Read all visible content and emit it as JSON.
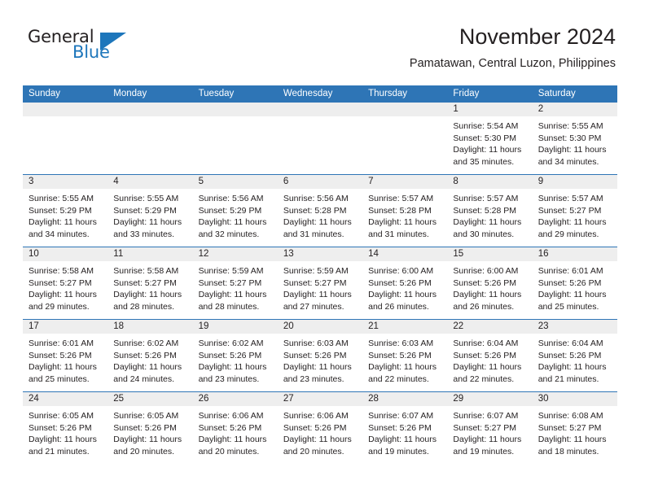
{
  "logo": {
    "word_top": "General",
    "word_bottom": "Blue",
    "triangle_color": "#1d76bb"
  },
  "header": {
    "title": "November 2024",
    "subtitle": "Pamatawan, Central Luzon, Philippines"
  },
  "colors": {
    "header_blue": "#2e75b6",
    "daynum_band": "#eeeeee",
    "text": "#231f20"
  },
  "weekdays": [
    "Sunday",
    "Monday",
    "Tuesday",
    "Wednesday",
    "Thursday",
    "Friday",
    "Saturday"
  ],
  "weeks": [
    [
      {
        "empty": true
      },
      {
        "empty": true
      },
      {
        "empty": true
      },
      {
        "empty": true
      },
      {
        "empty": true
      },
      {
        "day": "1",
        "sunrise": "Sunrise: 5:54 AM",
        "sunset": "Sunset: 5:30 PM",
        "daylight1": "Daylight: 11 hours",
        "daylight2": "and 35 minutes."
      },
      {
        "day": "2",
        "sunrise": "Sunrise: 5:55 AM",
        "sunset": "Sunset: 5:30 PM",
        "daylight1": "Daylight: 11 hours",
        "daylight2": "and 34 minutes."
      }
    ],
    [
      {
        "day": "3",
        "sunrise": "Sunrise: 5:55 AM",
        "sunset": "Sunset: 5:29 PM",
        "daylight1": "Daylight: 11 hours",
        "daylight2": "and 34 minutes."
      },
      {
        "day": "4",
        "sunrise": "Sunrise: 5:55 AM",
        "sunset": "Sunset: 5:29 PM",
        "daylight1": "Daylight: 11 hours",
        "daylight2": "and 33 minutes."
      },
      {
        "day": "5",
        "sunrise": "Sunrise: 5:56 AM",
        "sunset": "Sunset: 5:29 PM",
        "daylight1": "Daylight: 11 hours",
        "daylight2": "and 32 minutes."
      },
      {
        "day": "6",
        "sunrise": "Sunrise: 5:56 AM",
        "sunset": "Sunset: 5:28 PM",
        "daylight1": "Daylight: 11 hours",
        "daylight2": "and 31 minutes."
      },
      {
        "day": "7",
        "sunrise": "Sunrise: 5:57 AM",
        "sunset": "Sunset: 5:28 PM",
        "daylight1": "Daylight: 11 hours",
        "daylight2": "and 31 minutes."
      },
      {
        "day": "8",
        "sunrise": "Sunrise: 5:57 AM",
        "sunset": "Sunset: 5:28 PM",
        "daylight1": "Daylight: 11 hours",
        "daylight2": "and 30 minutes."
      },
      {
        "day": "9",
        "sunrise": "Sunrise: 5:57 AM",
        "sunset": "Sunset: 5:27 PM",
        "daylight1": "Daylight: 11 hours",
        "daylight2": "and 29 minutes."
      }
    ],
    [
      {
        "day": "10",
        "sunrise": "Sunrise: 5:58 AM",
        "sunset": "Sunset: 5:27 PM",
        "daylight1": "Daylight: 11 hours",
        "daylight2": "and 29 minutes."
      },
      {
        "day": "11",
        "sunrise": "Sunrise: 5:58 AM",
        "sunset": "Sunset: 5:27 PM",
        "daylight1": "Daylight: 11 hours",
        "daylight2": "and 28 minutes."
      },
      {
        "day": "12",
        "sunrise": "Sunrise: 5:59 AM",
        "sunset": "Sunset: 5:27 PM",
        "daylight1": "Daylight: 11 hours",
        "daylight2": "and 28 minutes."
      },
      {
        "day": "13",
        "sunrise": "Sunrise: 5:59 AM",
        "sunset": "Sunset: 5:27 PM",
        "daylight1": "Daylight: 11 hours",
        "daylight2": "and 27 minutes."
      },
      {
        "day": "14",
        "sunrise": "Sunrise: 6:00 AM",
        "sunset": "Sunset: 5:26 PM",
        "daylight1": "Daylight: 11 hours",
        "daylight2": "and 26 minutes."
      },
      {
        "day": "15",
        "sunrise": "Sunrise: 6:00 AM",
        "sunset": "Sunset: 5:26 PM",
        "daylight1": "Daylight: 11 hours",
        "daylight2": "and 26 minutes."
      },
      {
        "day": "16",
        "sunrise": "Sunrise: 6:01 AM",
        "sunset": "Sunset: 5:26 PM",
        "daylight1": "Daylight: 11 hours",
        "daylight2": "and 25 minutes."
      }
    ],
    [
      {
        "day": "17",
        "sunrise": "Sunrise: 6:01 AM",
        "sunset": "Sunset: 5:26 PM",
        "daylight1": "Daylight: 11 hours",
        "daylight2": "and 25 minutes."
      },
      {
        "day": "18",
        "sunrise": "Sunrise: 6:02 AM",
        "sunset": "Sunset: 5:26 PM",
        "daylight1": "Daylight: 11 hours",
        "daylight2": "and 24 minutes."
      },
      {
        "day": "19",
        "sunrise": "Sunrise: 6:02 AM",
        "sunset": "Sunset: 5:26 PM",
        "daylight1": "Daylight: 11 hours",
        "daylight2": "and 23 minutes."
      },
      {
        "day": "20",
        "sunrise": "Sunrise: 6:03 AM",
        "sunset": "Sunset: 5:26 PM",
        "daylight1": "Daylight: 11 hours",
        "daylight2": "and 23 minutes."
      },
      {
        "day": "21",
        "sunrise": "Sunrise: 6:03 AM",
        "sunset": "Sunset: 5:26 PM",
        "daylight1": "Daylight: 11 hours",
        "daylight2": "and 22 minutes."
      },
      {
        "day": "22",
        "sunrise": "Sunrise: 6:04 AM",
        "sunset": "Sunset: 5:26 PM",
        "daylight1": "Daylight: 11 hours",
        "daylight2": "and 22 minutes."
      },
      {
        "day": "23",
        "sunrise": "Sunrise: 6:04 AM",
        "sunset": "Sunset: 5:26 PM",
        "daylight1": "Daylight: 11 hours",
        "daylight2": "and 21 minutes."
      }
    ],
    [
      {
        "day": "24",
        "sunrise": "Sunrise: 6:05 AM",
        "sunset": "Sunset: 5:26 PM",
        "daylight1": "Daylight: 11 hours",
        "daylight2": "and 21 minutes."
      },
      {
        "day": "25",
        "sunrise": "Sunrise: 6:05 AM",
        "sunset": "Sunset: 5:26 PM",
        "daylight1": "Daylight: 11 hours",
        "daylight2": "and 20 minutes."
      },
      {
        "day": "26",
        "sunrise": "Sunrise: 6:06 AM",
        "sunset": "Sunset: 5:26 PM",
        "daylight1": "Daylight: 11 hours",
        "daylight2": "and 20 minutes."
      },
      {
        "day": "27",
        "sunrise": "Sunrise: 6:06 AM",
        "sunset": "Sunset: 5:26 PM",
        "daylight1": "Daylight: 11 hours",
        "daylight2": "and 20 minutes."
      },
      {
        "day": "28",
        "sunrise": "Sunrise: 6:07 AM",
        "sunset": "Sunset: 5:26 PM",
        "daylight1": "Daylight: 11 hours",
        "daylight2": "and 19 minutes."
      },
      {
        "day": "29",
        "sunrise": "Sunrise: 6:07 AM",
        "sunset": "Sunset: 5:27 PM",
        "daylight1": "Daylight: 11 hours",
        "daylight2": "and 19 minutes."
      },
      {
        "day": "30",
        "sunrise": "Sunrise: 6:08 AM",
        "sunset": "Sunset: 5:27 PM",
        "daylight1": "Daylight: 11 hours",
        "daylight2": "and 18 minutes."
      }
    ]
  ]
}
